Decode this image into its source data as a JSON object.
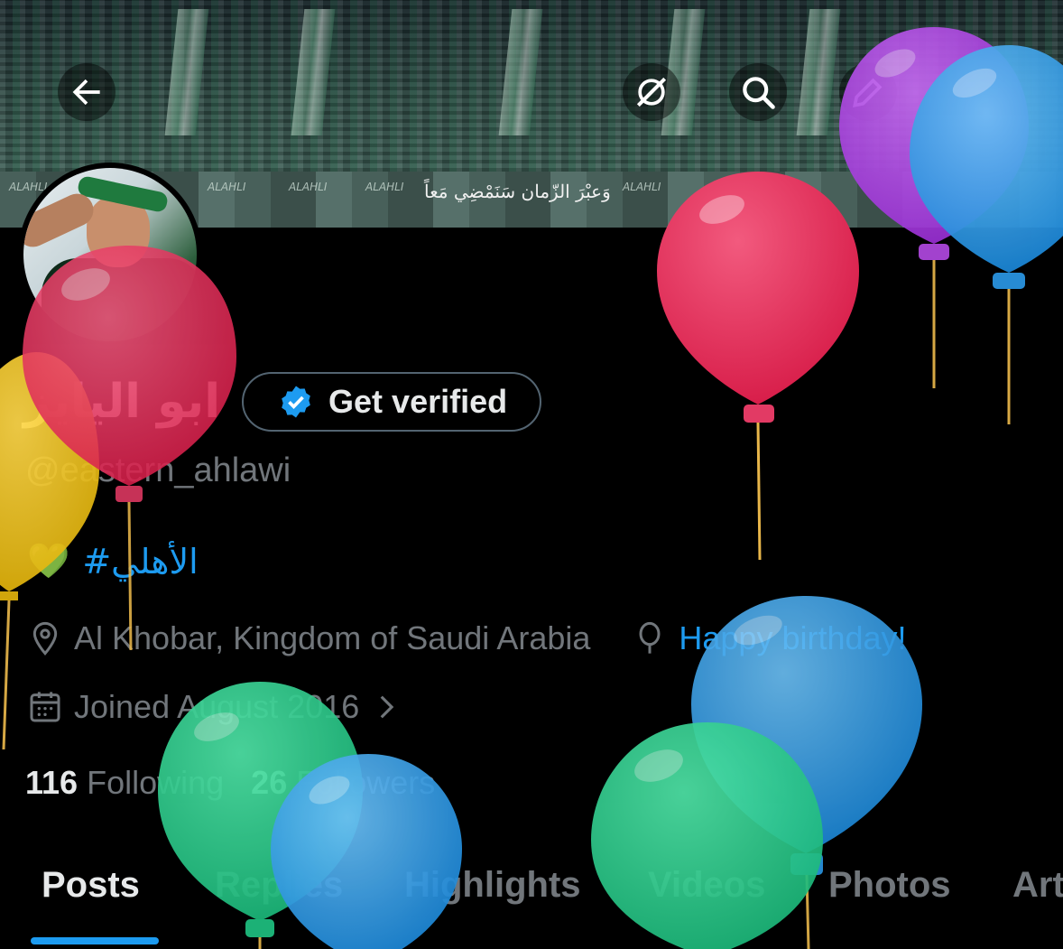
{
  "banner": {
    "caption": "وَعبْرَ الزّمان سَنَمْضِي مَعاً",
    "brand_text": "ALAHLI"
  },
  "header_buttons": {
    "back_icon": "arrow-left-icon",
    "grok_icon": "grok-icon",
    "search_icon": "search-icon",
    "edit_icon": "pencil-icon"
  },
  "profile": {
    "display_name": "ابو اليايز",
    "verify_label": "Get verified",
    "handle": "@eastern_ahlawi",
    "bio_emoji": "💚",
    "bio_hashtag": "#الأهلي",
    "location": "Al Khobar, Kingdom of Saudi Arabia",
    "birthday_text": "Happy birthday!",
    "joined": "Joined August 2016",
    "following_count": "116",
    "following_label": "Following",
    "followers_count": "26",
    "followers_label": "Followers"
  },
  "tabs": [
    "Posts",
    "Replies",
    "Highlights",
    "Videos",
    "Photos",
    "Art"
  ],
  "colors": {
    "accent": "#1d9bf0",
    "muted": "#71767b",
    "text": "#e7e9ea",
    "background": "#000000"
  }
}
